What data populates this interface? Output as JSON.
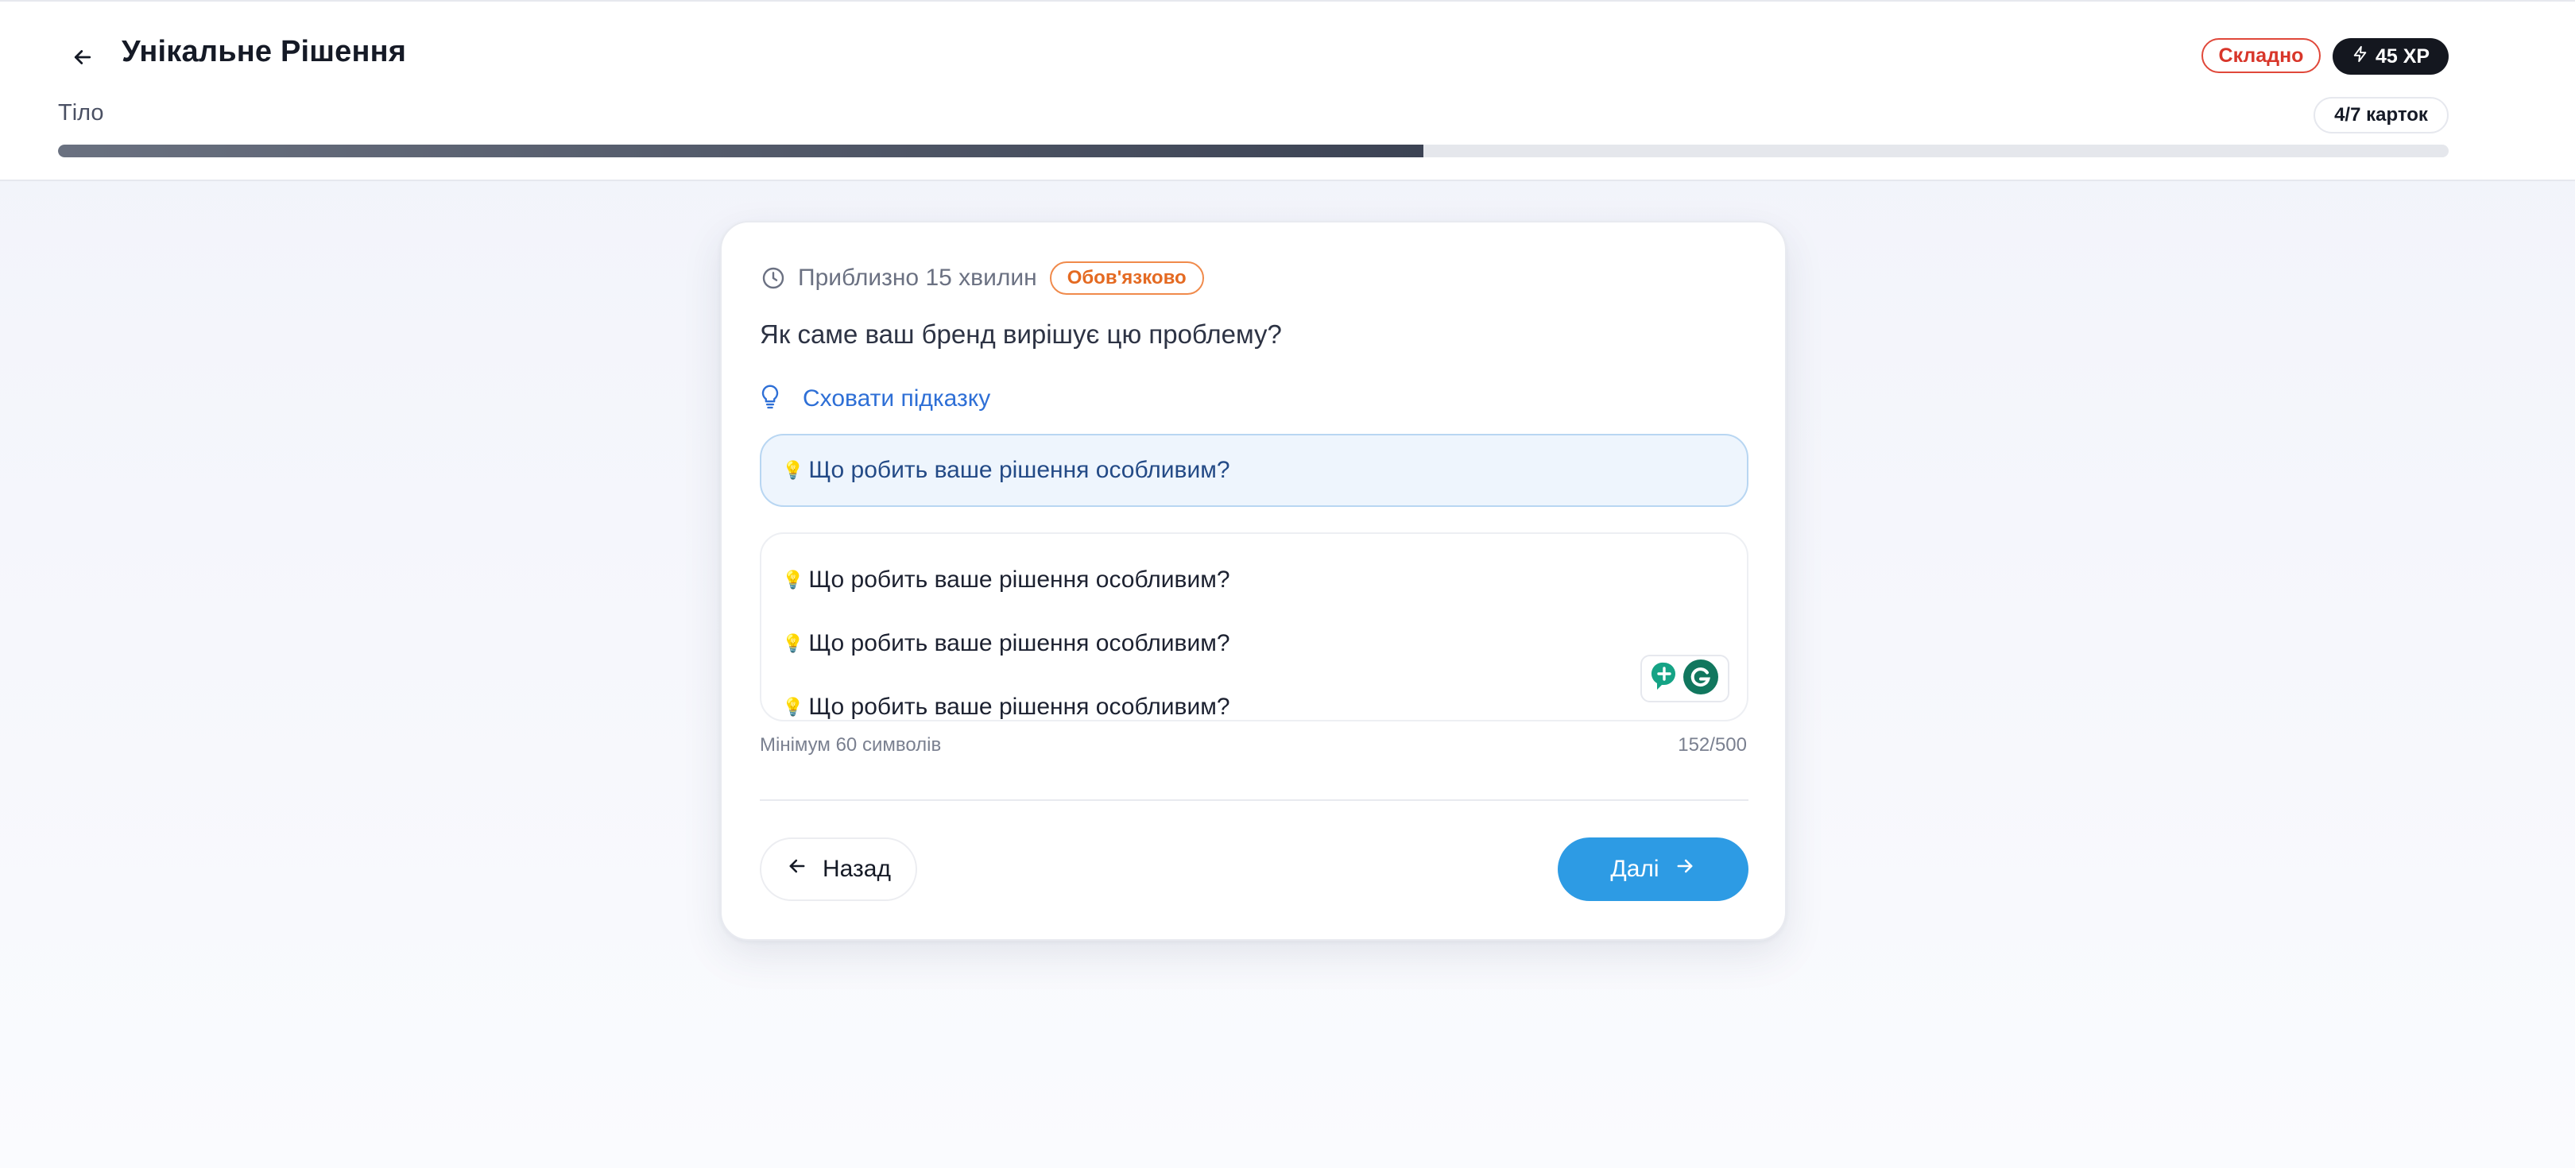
{
  "header": {
    "title": "Унікальне Рішення",
    "difficulty": "Складно",
    "xp": "45 XP",
    "section": "Тіло",
    "cards_counter": "4/7 карток",
    "progress_fraction": 0.571,
    "icons": {
      "back": "arrow-left-icon",
      "xp": "lightning-icon"
    }
  },
  "card": {
    "time_estimate": "Приблизно 15 хвилин",
    "required_badge": "Обов'язково",
    "question": "Як саме ваш бренд вирішує цю проблему?",
    "hint_toggle_label": "Сховати підказку",
    "hint_text": "Що робить ваше рішення особливим?",
    "answer_lines": [
      "Що робить ваше рішення особливим?",
      "Що робить ваше рішення особливим?",
      "Що робить ваше рішення особливим?"
    ],
    "min_chars_note": "Мінімум 60 символів",
    "char_count": "152/500",
    "back_label": "Назад",
    "next_label": "Далі",
    "icons": {
      "time": "clock-icon",
      "hint": "lightbulb-icon",
      "emoji": "lightbulb-emoji-icon",
      "grammarly": "grammarly-icon",
      "back": "arrow-left-icon",
      "next": "arrow-right-icon"
    }
  },
  "colors": {
    "accent": "#2d9be4",
    "danger": "#d8362a",
    "warning": "#e46a22",
    "link": "#2e6fd6"
  }
}
